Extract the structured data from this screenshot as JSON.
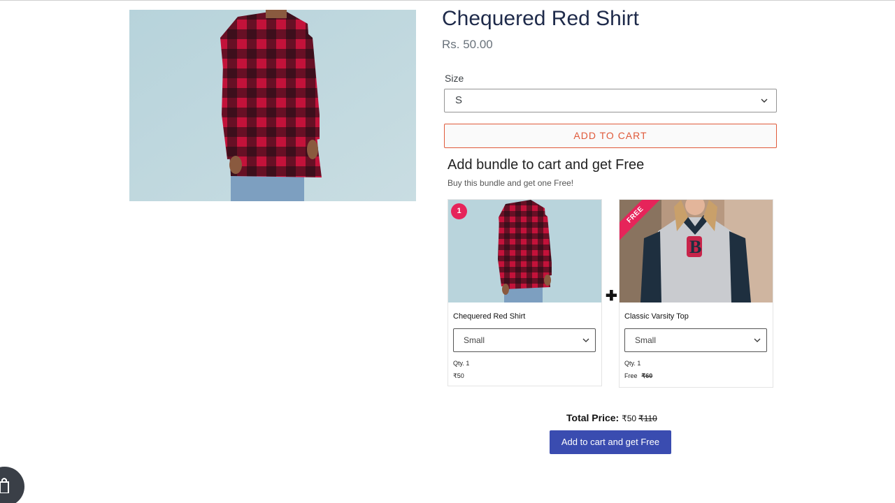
{
  "product": {
    "title": "Chequered Red Shirt",
    "price": "Rs. 50.00",
    "image_icon": "checkered-shirt-photo"
  },
  "size": {
    "label": "Size",
    "selected": "S"
  },
  "actions": {
    "add_to_cart": "ADD TO CART"
  },
  "bundle": {
    "title": "Add bundle to cart and get Free",
    "subtitle": "Buy this bundle and get one Free!",
    "badge": "1",
    "free_ribbon": "FREE",
    "plus": "✚",
    "items": [
      {
        "name": "Chequered Red Shirt",
        "size": "Small",
        "qty": "Qty. 1",
        "price": "₹50",
        "old_price": ""
      },
      {
        "name": "Classic Varsity Top",
        "size": "Small",
        "qty": "Qty. 1",
        "price": "Free",
        "old_price": "₹60"
      }
    ],
    "total_label": "Total Price:",
    "total_price": "₹50",
    "total_old_price": "₹110",
    "button": "Add to cart and get Free"
  },
  "colors": {
    "accent_orange": "#e05a3a",
    "button_blue": "#3a4cb0",
    "badge_pink": "#e6245a",
    "title_navy": "#1e2a4a"
  }
}
